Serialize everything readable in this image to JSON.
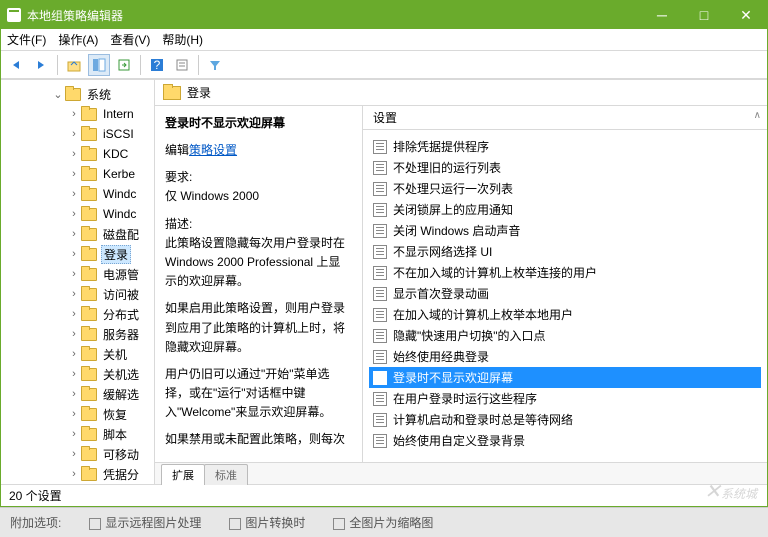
{
  "window": {
    "title": "本地组策略编辑器"
  },
  "menu": {
    "file": "文件(F)",
    "action": "操作(A)",
    "view": "查看(V)",
    "help": "帮助(H)"
  },
  "tree": {
    "root": "系统",
    "items": [
      "Intern",
      "iSCSI",
      "KDC",
      "Kerbe",
      "Windc",
      "Windc",
      "磁盘配",
      "登录",
      "电源管",
      "访问被",
      "分布式",
      "服务器",
      "关机",
      "关机选",
      "缓解选",
      "恢复",
      "脚本",
      "可移动",
      "凭据分"
    ],
    "selected_index": 7
  },
  "header": {
    "title": "登录"
  },
  "detail": {
    "policy_title": "登录时不显示欢迎屏幕",
    "edit_prefix": "编辑",
    "edit_link": "策略设置",
    "req_label": "要求:",
    "req_value": "仅 Windows 2000",
    "desc_label": "描述:",
    "desc1": "此策略设置隐藏每次用户登录时在 Windows 2000 Professional 上显示的欢迎屏幕。",
    "desc2": "如果启用此策略设置，则用户登录到应用了此策略的计算机上时，将隐藏欢迎屏幕。",
    "desc3": "用户仍旧可以通过\"开始\"菜单选择，或在\"运行\"对话框中键入\"Welcome\"来显示欢迎屏幕。",
    "desc4": "如果禁用或未配置此策略，则每次"
  },
  "list": {
    "column_header": "设置",
    "items": [
      "排除凭据提供程序",
      "不处理旧的运行列表",
      "不处理只运行一次列表",
      "关闭锁屏上的应用通知",
      "关闭 Windows 启动声音",
      "不显示网络选择 UI",
      "不在加入域的计算机上枚举连接的用户",
      "显示首次登录动画",
      "在加入域的计算机上枚举本地用户",
      "隐藏\"快速用户切换\"的入口点",
      "始终使用经典登录",
      "登录时不显示欢迎屏幕",
      "在用户登录时运行这些程序",
      "计算机启动和登录时总是等待网络",
      "始终使用自定义登录背景"
    ],
    "selected_index": 11
  },
  "tabs": {
    "extended": "扩展",
    "standard": "标准"
  },
  "status": {
    "count": "20 个设置"
  },
  "below": {
    "label1": "附加选项:",
    "check1": "显示远程图片处理",
    "check2": "图片转换时",
    "check3": "全图片为缩略图"
  },
  "watermark": "系统城"
}
